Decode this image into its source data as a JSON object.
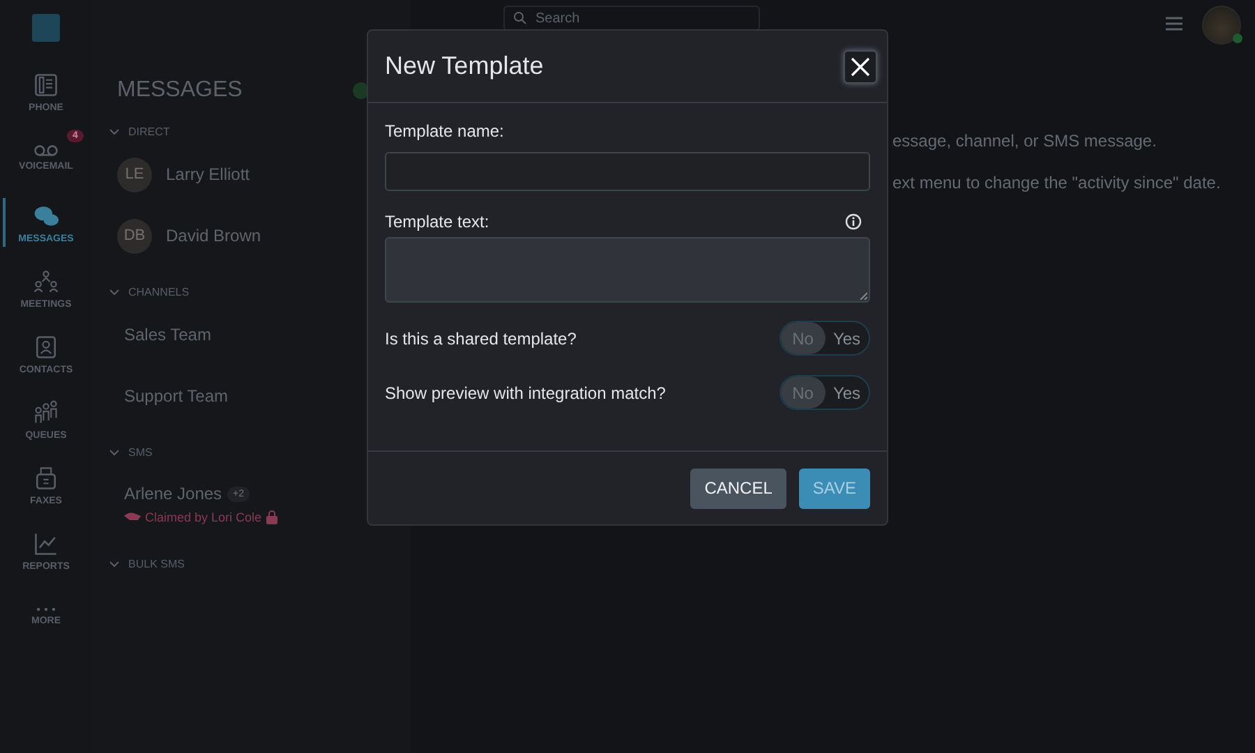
{
  "nav": [
    {
      "label": "PHONE",
      "selected": false
    },
    {
      "label": "VOICEMAIL",
      "selected": false,
      "badge": "4"
    },
    {
      "label": "MESSAGES",
      "selected": true
    },
    {
      "label": "MEETINGS",
      "selected": false
    },
    {
      "label": "CONTACTS",
      "selected": false
    },
    {
      "label": "QUEUES",
      "selected": false
    },
    {
      "label": "FAXES",
      "selected": false
    },
    {
      "label": "REPORTS",
      "selected": false
    },
    {
      "label": "MORE",
      "selected": false
    }
  ],
  "messages": {
    "title": "MESSAGES",
    "sections": [
      {
        "label": "DIRECT",
        "expanded": true,
        "items": [
          {
            "kind": "contact",
            "initials": "LE",
            "name": "Larry Elliott"
          },
          {
            "kind": "contact",
            "initials": "DB",
            "name": "David Brown"
          }
        ]
      },
      {
        "label": "CHANNELS",
        "expanded": true,
        "items": [
          {
            "kind": "channel",
            "name": "Sales Team"
          },
          {
            "kind": "channel",
            "name": "Support Team"
          }
        ]
      },
      {
        "label": "SMS",
        "expanded": true,
        "items": [
          {
            "kind": "sms",
            "name": "Arlene Jones",
            "badge": "+2",
            "claim": "Claimed by Lori Cole"
          }
        ]
      },
      {
        "label": "BULK SMS",
        "expanded": true
      }
    ]
  },
  "search": {
    "placeholder": "Search"
  },
  "main_text": [
    "essage, channel, or SMS message.",
    "ext menu to change the \"activity since\" date."
  ],
  "dialog": {
    "title": "New Template",
    "name_field": {
      "label": "Template name:"
    },
    "text_field": {
      "label": "Template text:"
    },
    "toggles": [
      {
        "label": "Is this a shared template?",
        "options": [
          {
            "label": "No",
            "selected": true
          },
          {
            "label": "Yes",
            "selected": false
          }
        ]
      },
      {
        "label": "Show preview with integration match?",
        "options": [
          {
            "label": "No",
            "selected": true
          },
          {
            "label": "Yes",
            "selected": false
          }
        ]
      }
    ],
    "buttons": [
      {
        "label": "CANCEL",
        "kind": "secondary",
        "disabled": false
      },
      {
        "label": "SAVE",
        "kind": "primary",
        "disabled": true
      }
    ]
  }
}
